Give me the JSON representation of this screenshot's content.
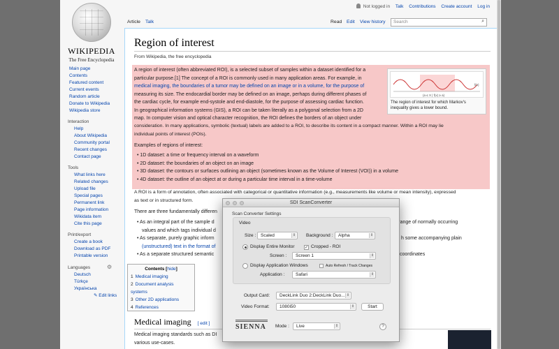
{
  "wiki": {
    "logo": {
      "word": "WIKIPEDIA",
      "tagline": "The Free Encyclopedia",
      "icon": "wikipedia-globe"
    },
    "personal": [
      "Not logged in",
      "Talk",
      "Contributions",
      "Create account",
      "Log in"
    ],
    "tabs": {
      "article": "Article",
      "talk": "Talk",
      "read": "Read",
      "edit": "Edit",
      "history": "View history"
    },
    "search": {
      "placeholder": "Search"
    },
    "sidebar": {
      "main": [
        "Main page",
        "Contents",
        "Featured content",
        "Current events",
        "Random article",
        "Donate to Wikipedia",
        "Wikipedia store"
      ],
      "interaction_title": "Interaction",
      "interaction": [
        "Help",
        "About Wikipedia",
        "Community portal",
        "Recent changes",
        "Contact page"
      ],
      "tools_title": "Tools",
      "tools": [
        "What links here",
        "Related changes",
        "Upload file",
        "Special pages",
        "Permanent link",
        "Page information",
        "Wikidata item",
        "Cite this page"
      ],
      "print_title": "Print/export",
      "print": [
        "Create a book",
        "Download as PDF",
        "Printable version"
      ],
      "languages_title": "Languages",
      "languages": [
        "Deutsch",
        "Türkçe",
        "Українська"
      ],
      "edit_links": "Edit links"
    },
    "article": {
      "title": "Region of interest",
      "from": "From Wikipedia, the free encyclopedia",
      "intro_lines": [
        "A region of interest (often abbreviated ROI), is a selected subset of samples within a dataset identified for a",
        "particular purpose.[1] The concept of a ROI is commonly used in many application areas. For example, in",
        "medical imaging, the boundaries of a tumor may be defined on an image or in a volume, for the purpose of",
        "measuring its size. The endocardial border may be defined on an image, perhaps during different phases of",
        "the cardiac cycle, for example end-systole and end-diastole, for the purpose of assessing cardiac function.",
        "In geographical information systems (GIS), a ROI can be taken literally as a polygonal selection from a 2D",
        "map. In computer vision and optical character recognition, the ROI defines the borders of an object under",
        "consideration. In many applications, symbolic (textual) labels are added to a ROI, to describe its content in a compact manner. Within a ROI may lie",
        "individual points of interest (POIs)."
      ],
      "examples_title": "Examples of regions of interest:",
      "examples": [
        "1D dataset: a time or frequency interval on a waveform",
        "2D dataset: the boundaries of an object on an image",
        "3D dataset: the contours or surfaces outlining an object (sometimes known as the Volume of Interest (VOI)) in a volume",
        "4D dataset: the outline of an object at or during a particular time interval in a time-volume"
      ],
      "annotation_lines": [
        "A ROI is a form of annotation, often associated with categorical or quantitative information (e.g., measurements like volume or mean intensity), expressed",
        "as text or in structured form."
      ],
      "three_prefix": "There are three fundamentally differen",
      "bullets_left": [
        "As an integral part of the sample d",
        "values and which tags individual d",
        "As separate, purely graphic inform",
        "(unstructured) text in the format of",
        "As a separate structured semantic"
      ],
      "bullets_right": [
        "nal range of normally occurring",
        "h some accompanying plain",
        "coordinates"
      ],
      "thumb_caption": "The region of interest for which Markov's inequality gives a lower bound.",
      "thumb_label": "(a ≤ X | f(x) ≥ a)",
      "thumb_fx": "f(x)",
      "toc": {
        "title": "Contents",
        "hide": "hide",
        "items": [
          {
            "num": "1",
            "label": "Medical imaging"
          },
          {
            "num": "2",
            "label": "Document analysis systems"
          },
          {
            "num": "3",
            "label": "Other 2D applications"
          },
          {
            "num": "4",
            "label": "References"
          }
        ]
      },
      "h2": "Medical imaging",
      "h2_edit": "[ edit ]",
      "last_lines": [
        "Medical imaging standards such as DI",
        "various use-cases."
      ]
    }
  },
  "sdi": {
    "title": "SDI ScanConverter",
    "settings_label": "Scan Converter Settings",
    "video_label": "Video",
    "size_label": "Size :",
    "size_value": "Scaled",
    "background_label": "Background :",
    "background_value": "Alpha",
    "entire_monitor_label": "Display Entire Monitor",
    "cropped_label": "Cropped - ROI",
    "screen_label": "Screen :",
    "screen_value": "Screen 1",
    "app_windows_label": "Display Application Windows",
    "auto_refresh_label": "Auto Refresh / Track Changes",
    "application_label": "Application :",
    "application_value": "Safari",
    "output_card_label": "Output Card:",
    "output_card_value": "DeckLink Duo 2:DeckLink Duo...",
    "video_format_label": "Video Format:",
    "video_format_value": "1080i50",
    "start_label": "Start",
    "brand": "SIENNA",
    "mode_label": "Mode :",
    "mode_value": "Live",
    "help_label": "?"
  }
}
